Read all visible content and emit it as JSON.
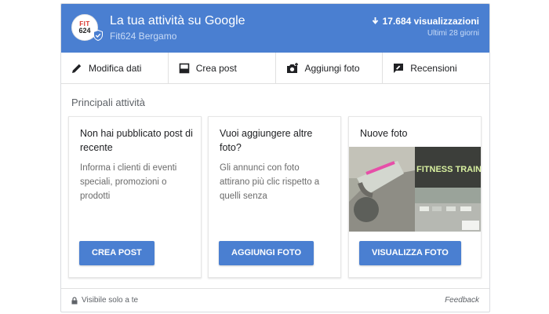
{
  "header": {
    "logo_text_top": "FIT",
    "logo_text_bottom": "624",
    "title": "La tua attività su Google",
    "business_name": "Fit624 Bergamo",
    "views": "17.684 visualizzazioni",
    "period": "Ultimi 28 giorni",
    "colors": {
      "brand": "#4a7fd1",
      "logo_red": "#d9342b"
    }
  },
  "toolbar": [
    {
      "label": "Modifica dati",
      "icon": "pencil-icon"
    },
    {
      "label": "Crea post",
      "icon": "post-icon"
    },
    {
      "label": "Aggiungi foto",
      "icon": "camera-add-icon"
    },
    {
      "label": "Recensioni",
      "icon": "review-icon"
    }
  ],
  "main": {
    "section_title": "Principali attività",
    "cards": [
      {
        "title": "Non hai pubblicato post di recente",
        "body": "Informa i clienti di eventi speciali, promozioni o prodotti",
        "button": "CREA POST"
      },
      {
        "title": "Vuoi aggiungere altre foto?",
        "body": "Gli annunci con foto attirano più clic rispetto a quelli senza",
        "button": "AGGIUNGI FOTO"
      },
      {
        "title": "Nuove foto",
        "photo_sign_text": "FITNESS TRAINER",
        "button": "VISUALIZZA FOTO"
      }
    ]
  },
  "footer": {
    "visibility": "Visibile solo a te",
    "feedback": "Feedback"
  }
}
